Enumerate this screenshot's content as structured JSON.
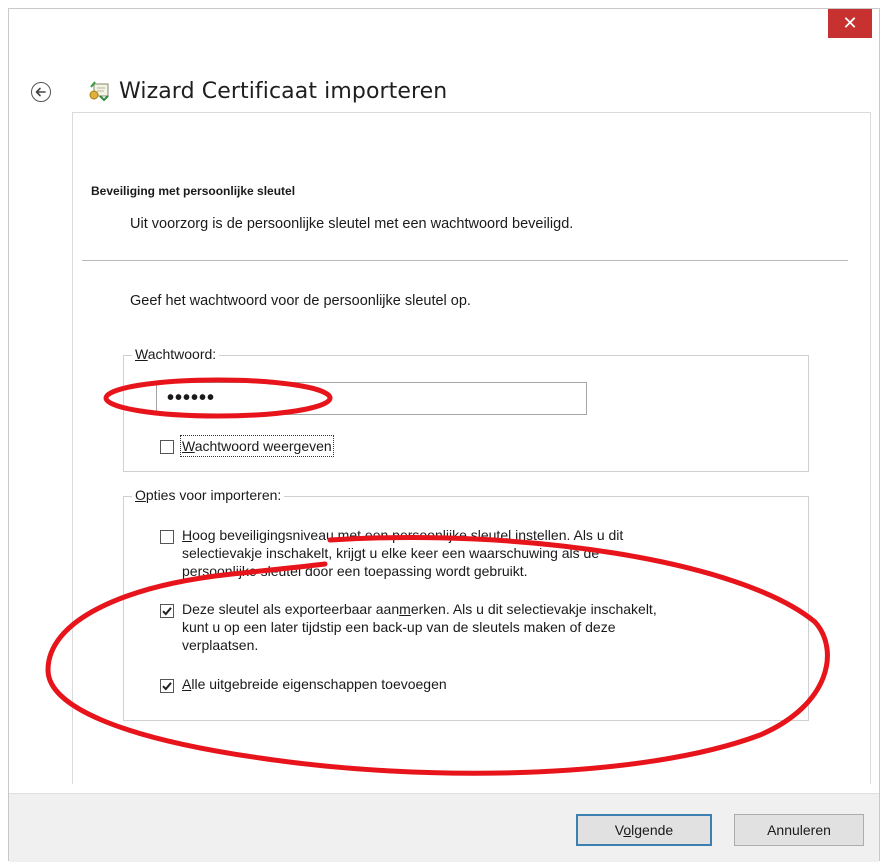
{
  "window": {
    "title": "Wizard Certificaat importeren",
    "close_glyph": "✕",
    "accent_close": "#c7312f"
  },
  "page": {
    "heading": "Beveiliging met persoonlijke sleutel",
    "description": "Uit voorzorg is de persoonlijke sleutel met een wachtwoord beveiligd.",
    "prompt": "Geef het wachtwoord voor de persoonlijke sleutel op."
  },
  "password_group": {
    "label_mnemonic": "W",
    "label_rest": "achtwoord:",
    "value": "••••••",
    "show_password": {
      "checked": false,
      "label_mnemonic": "W",
      "label_rest": "achtwoord weergeven"
    }
  },
  "options_group": {
    "label_mnemonic": "O",
    "label_rest": "pties voor importeren:",
    "options": [
      {
        "checked": false,
        "line1_mnemonic": "H",
        "line1_rest": "oog beveiligingsniveau met een persoonlijke sleutel instellen. Als u dit",
        "line2": "selectievakje inschakelt, krijgt u elke keer een waarschuwing als de",
        "line3": "persoonlijke sleutel door een toepassing wordt gebruikt."
      },
      {
        "checked": true,
        "line1_pre": "Deze sleutel als exporteerbaar aan",
        "line1_mnemonic": "m",
        "line1_post": "erken. Als u dit selectievakje inschakelt,",
        "line2": "kunt u op een later tijdstip een back-up van de sleutels maken of deze",
        "line3": "verplaatsen."
      },
      {
        "checked": true,
        "line1_mnemonic": "A",
        "line1_rest": "lle uitgebreide eigenschappen toevoegen"
      }
    ]
  },
  "footer": {
    "next_pre": "V",
    "next_mnemonic": "o",
    "next_post": "lgende",
    "cancel": "Annuleren"
  },
  "colors": {
    "annotation_red": "#e8141b",
    "primary_button_border": "#3c7fb1"
  }
}
